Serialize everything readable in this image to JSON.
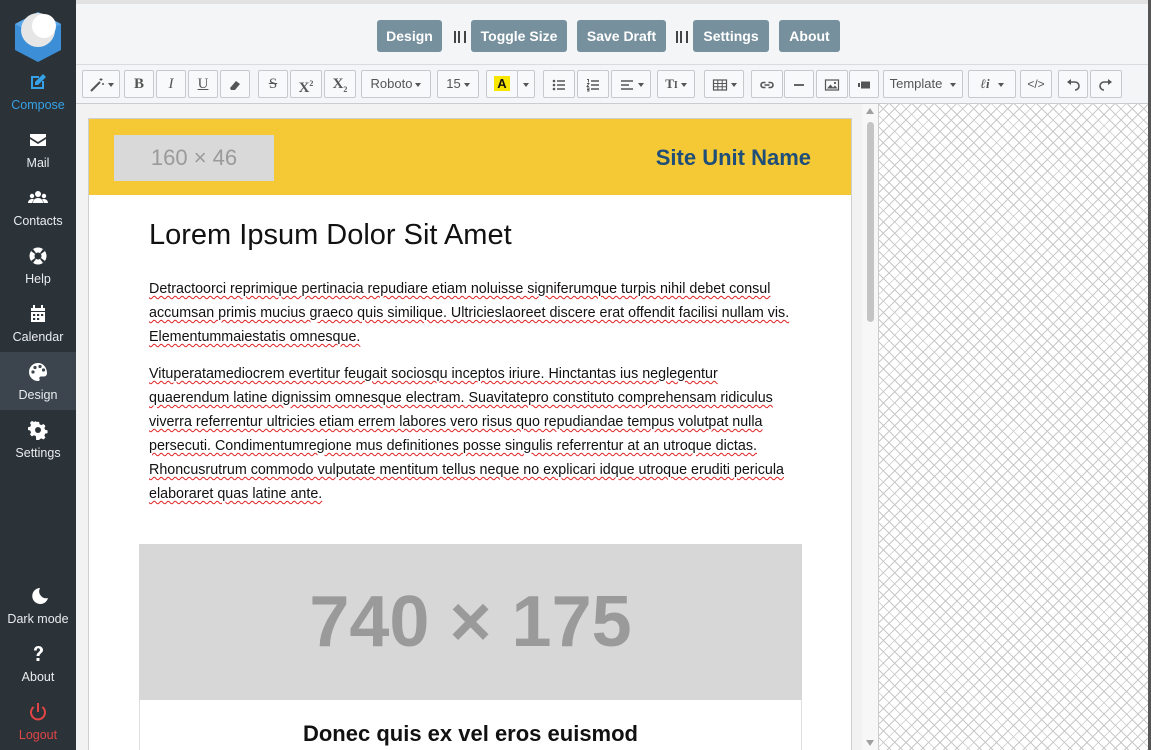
{
  "sidebar": {
    "items": [
      {
        "label": "Compose",
        "icon": "compose-icon"
      },
      {
        "label": "Mail",
        "icon": "mail-icon"
      },
      {
        "label": "Contacts",
        "icon": "contacts-icon"
      },
      {
        "label": "Help",
        "icon": "help-lifebuoy-icon"
      },
      {
        "label": "Calendar",
        "icon": "calendar-icon"
      },
      {
        "label": "Design",
        "icon": "palette-icon"
      },
      {
        "label": "Settings",
        "icon": "gear-icon"
      }
    ],
    "bottom": [
      {
        "label": "Dark mode",
        "icon": "moon-icon"
      },
      {
        "label": "About",
        "icon": "question-icon"
      },
      {
        "label": "Logout",
        "icon": "power-icon"
      }
    ],
    "accent_color": "#35a2e8",
    "logout_color": "#e14545"
  },
  "topbar": {
    "buttons": [
      "Design",
      "Toggle Size",
      "Save Draft",
      "Settings",
      "About"
    ],
    "button_color": "#77909d"
  },
  "toolbar": {
    "font_family": "Roboto",
    "font_size": "15",
    "template_label": "Template",
    "highlight_letter": "A",
    "highlight_color": "#f6e600"
  },
  "email": {
    "header_bg": "#f5c935",
    "logo_placeholder": "160 × 46",
    "site_unit": "Site Unit Name",
    "site_unit_color": "#1f4e79",
    "title": "Lorem Ipsum Dolor Sit Amet",
    "para1": "Detractoorci reprimique pertinacia repudiare etiam noluisse signiferumque turpis nihil debet consul accumsan primis mucius graeco quis similique. Ultricieslaoreet discere erat offendit facilisi nullam vis. Elementummaiestatis omnesque.",
    "para2": "Vituperatamediocrem evertitur feugait sociosqu inceptos iriure. Hinctantas ius neglegentur quaerendum latine dignissim omnesque electram. Suavitatepro constituto comprehensam ridiculus viverra referrentur ultricies etiam errem labores vero risus quo repudiandae tempus volutpat nulla persecuti. Condimentumregione mus definitiones posse singulis referrentur at an utroque dictas. Rhoncusrutrum commodo vulputate mentitum tellus neque no explicari idque utroque eruditi pericula elaboraret quas latine ante.",
    "banner_placeholder": "740 × 175",
    "subheading": "Donec quis ex vel eros euismod"
  }
}
